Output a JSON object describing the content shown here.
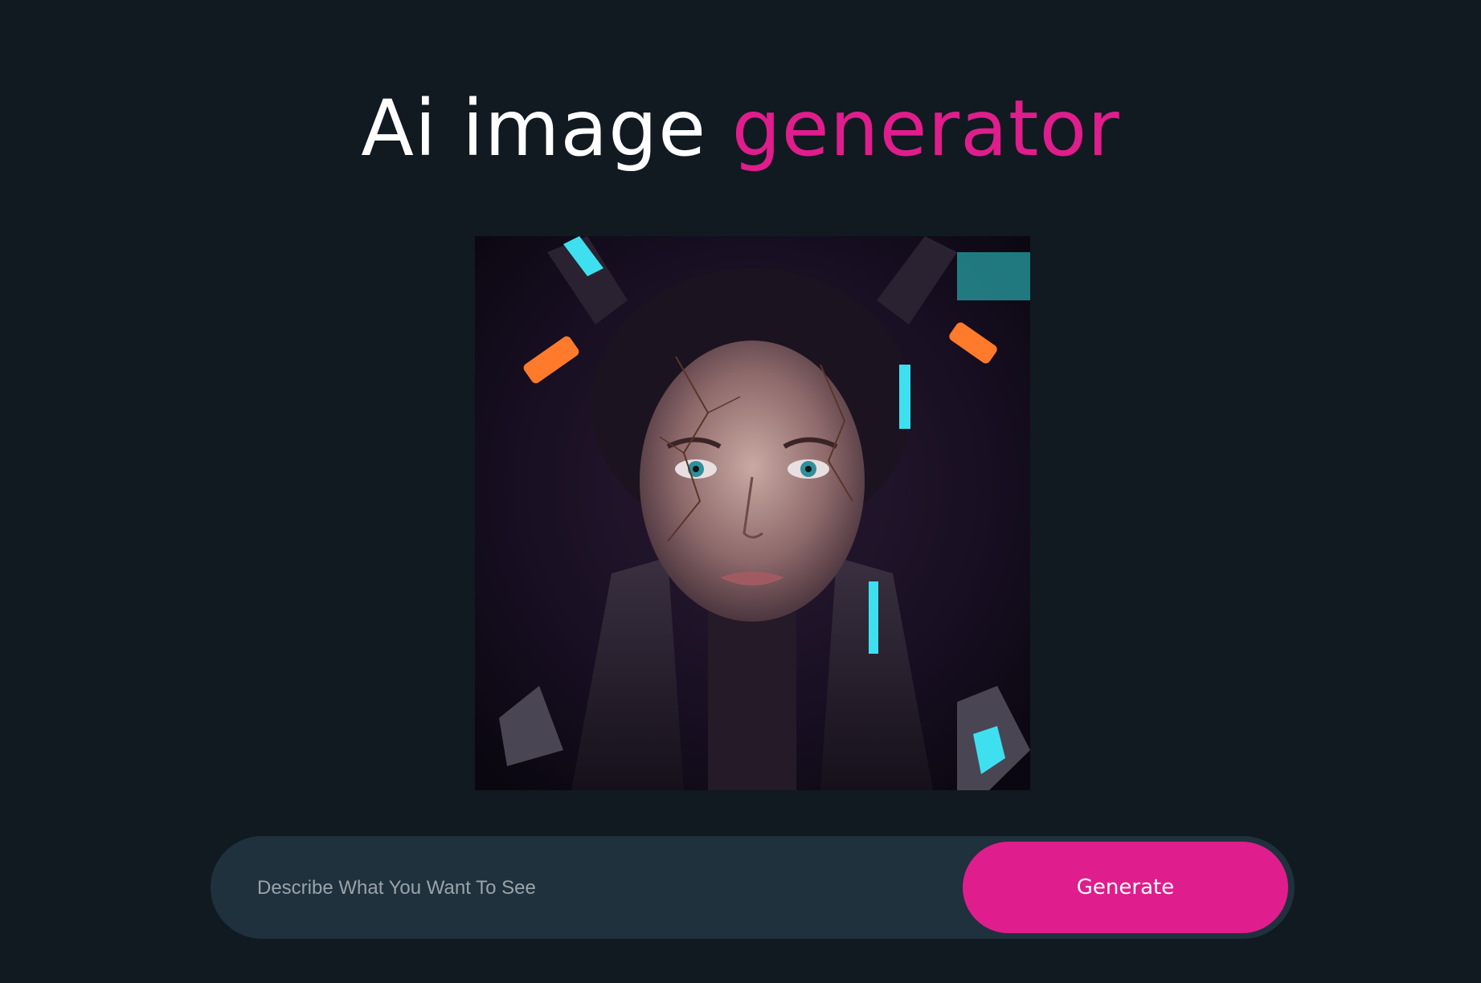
{
  "header": {
    "title_main": "Ai image",
    "title_accent": "generator"
  },
  "generated_image": {
    "description": "cyberpunk portrait",
    "icon": "generated-image"
  },
  "prompt": {
    "placeholder": "Describe What You Want To See",
    "value": ""
  },
  "actions": {
    "generate_label": "Generate"
  },
  "colors": {
    "background": "#101a20",
    "accent": "#e01d8c",
    "input_bar": "#1f313d",
    "title": "#ffffff"
  }
}
